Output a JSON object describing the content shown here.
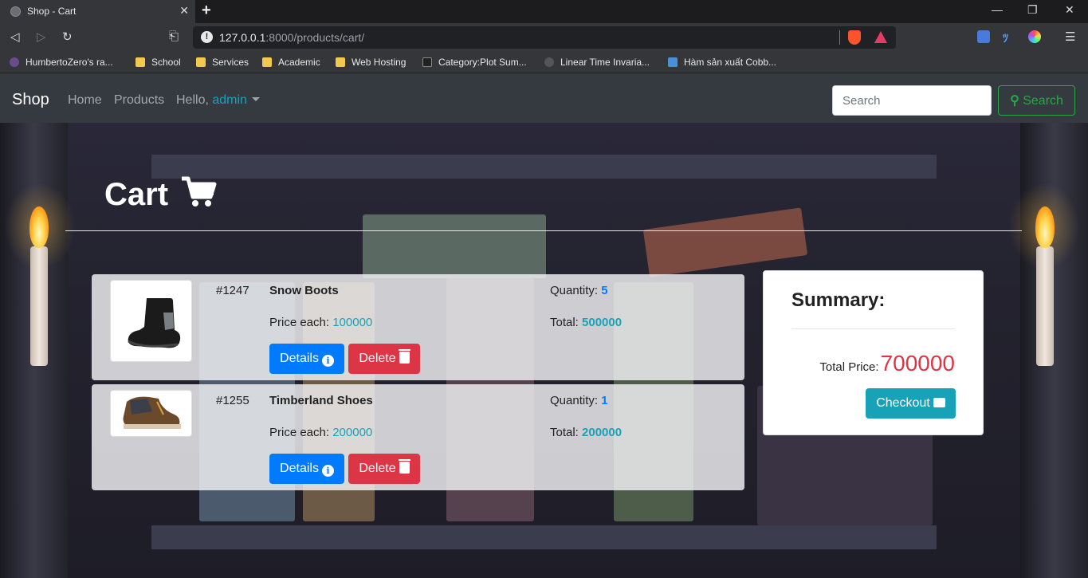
{
  "browser": {
    "tab_title": "Shop - Cart",
    "url_host": "127.0.0.1",
    "url_port": ":8000",
    "url_path": "/products/cart/",
    "bookmarks": [
      {
        "label": "HumbertoZero's ra...",
        "icon": "avatar-icon",
        "color": "#6a4c8c"
      },
      {
        "label": "School",
        "icon": "folder-icon",
        "color": "#f2c94c"
      },
      {
        "label": "Services",
        "icon": "folder-icon",
        "color": "#f2c94c"
      },
      {
        "label": "Academic",
        "icon": "folder-icon",
        "color": "#f2c94c"
      },
      {
        "label": "Web Hosting",
        "icon": "folder-icon",
        "color": "#f2c94c"
      },
      {
        "label": "Category:Plot Sum...",
        "icon": "site-icon",
        "color": "#222222"
      },
      {
        "label": "Linear Time Invaria...",
        "icon": "site-icon",
        "color": "#555555"
      },
      {
        "label": "Hàm sản xuất Cobb...",
        "icon": "site-icon",
        "color": "#4a90d9"
      }
    ]
  },
  "navbar": {
    "brand": "Shop",
    "links": [
      "Home",
      "Products"
    ],
    "hello_prefix": "Hello,",
    "username": "admin",
    "search_placeholder": "Search",
    "search_button": "Search"
  },
  "cart": {
    "title": "Cart",
    "price_each_label": "Price each:",
    "quantity_label": "Quantity:",
    "total_label": "Total:",
    "details_label": "Details",
    "delete_label": "Delete",
    "items": [
      {
        "id": "#1247",
        "name": "Snow Boots",
        "price": "100000",
        "quantity": "5",
        "total": "500000"
      },
      {
        "id": "#1255",
        "name": "Timberland Shoes",
        "price": "200000",
        "quantity": "1",
        "total": "200000"
      }
    ]
  },
  "summary": {
    "title": "Summary:",
    "total_label": "Total Price:",
    "total_value": "700000",
    "checkout_label": "Checkout"
  },
  "colors": {
    "primary": "#007bff",
    "danger": "#dc3545",
    "info": "#17a2b8",
    "success": "#28a745",
    "navbar": "#343a40"
  }
}
